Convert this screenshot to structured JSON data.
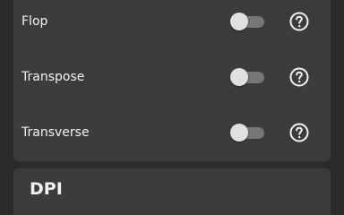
{
  "options": [
    {
      "label": "Flop",
      "enabled": false,
      "help_icon": "help-circle-icon"
    },
    {
      "label": "Transpose",
      "enabled": false,
      "help_icon": "help-circle-icon"
    },
    {
      "label": "Transverse",
      "enabled": false,
      "help_icon": "help-circle-icon"
    }
  ],
  "dpi": {
    "title": "DPI"
  },
  "colors": {
    "background": "#2b2b2b",
    "card": "#3c3c3c",
    "text": "#f2f2f2",
    "toggle_track_off": "#767676",
    "toggle_thumb_off": "#e0e0e0"
  }
}
